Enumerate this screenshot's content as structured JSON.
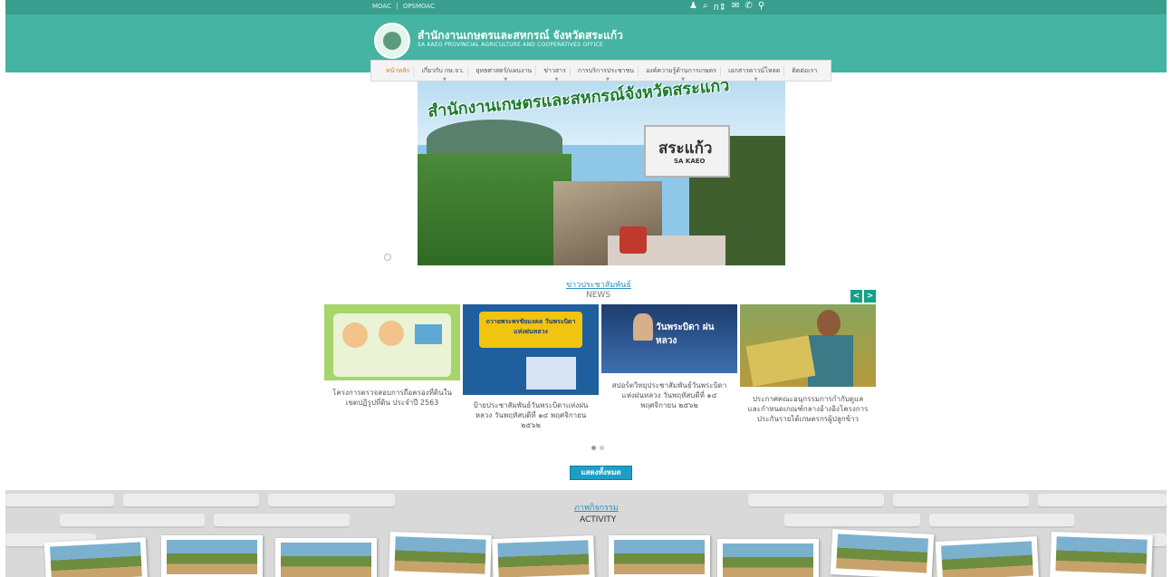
{
  "topbar": {
    "links": [
      "MOAC",
      "OPSMOAC"
    ],
    "icons": [
      "user-icon",
      "search-icon",
      "font-size-icon",
      "mail-icon",
      "phone-icon",
      "map-pin-icon"
    ],
    "font_size_label": "ก",
    "icon_glyphs": {
      "user": "♟",
      "search": "⌕",
      "mail": "✉",
      "phone": "✆",
      "pin": "⚲",
      "font_arrows": "⇕"
    }
  },
  "header": {
    "title": "สำนักงานเกษตรและสหกรณ์ จังหวัดสระแก้ว",
    "subtitle": "SA KAEO PROVINCIAL AGRICULTURE AND COOPERATIVES OFFICE"
  },
  "nav": {
    "items": [
      {
        "label": "หน้าหลัก"
      },
      {
        "label": "เกี่ยวกับ กษ.จว."
      },
      {
        "label": "ยุทธศาสตร์/แผนงาน"
      },
      {
        "label": "ข่าวสาร"
      },
      {
        "label": "การบริการประชาชน"
      },
      {
        "label": "องค์ความรู้ด้านการเกษตร"
      },
      {
        "label": "เอกสารดาวน์โหลด"
      },
      {
        "label": "ติดต่อเรา"
      }
    ]
  },
  "hero": {
    "banner_text": "สำนักงานเกษตรและสหกรณ์จังหวัดสระแก้ว",
    "sign_title": "สระแก้ว",
    "sign_sub": "SA KAEO"
  },
  "news": {
    "title": "ข่าวประชาสัมพันธ์",
    "subtitle": "NEWS",
    "prev": "<",
    "next": ">",
    "items": [
      {
        "caption": "โครงการตรวจสอบการถือครองที่ดินในเขตปฏิรูปที่ดิน ประจำปี 2563"
      },
      {
        "caption": "ป้ายประชาสัมพันธ์วันพระบิดาแห่งฝนหลวง วันพฤหัสบดีที่ ๑๔ พฤศจิกายน ๒๕๖๒",
        "thumb_title": "ถวายพระพรชัยมงคล วันพระบิดาแห่งฝนหลวง"
      },
      {
        "caption": "สปอร์ตวิทยุประชาสัมพันธ์วันพระบิดาแห่งฝนหลวง วันพฤหัสบดีที่ ๑๔ พฤศจิกายน ๒๕๖๒",
        "thumb_title": "วันพระบิดา ฝนหลวง"
      },
      {
        "caption": "ประกาศคณะอนุกรรมการกำกับดูแลและกำหนดเกณฑ์กลางอ้างอิงโครงการประกันรายได้เกษตรกรผู้ปลูกข้าว"
      }
    ],
    "show_all": "แสดงทั้งหมด"
  },
  "activity": {
    "title": "ภาพกิจกรรม",
    "subtitle": "ACTIVITY"
  }
}
